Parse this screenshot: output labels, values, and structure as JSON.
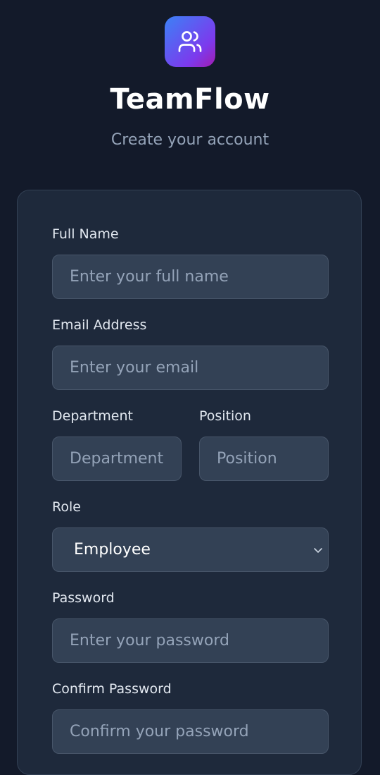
{
  "header": {
    "app_name": "TeamFlow",
    "subtitle": "Create your account",
    "logo_icon": "users-icon"
  },
  "form": {
    "full_name": {
      "label": "Full Name",
      "placeholder": "Enter your full name",
      "value": ""
    },
    "email": {
      "label": "Email Address",
      "placeholder": "Enter your email",
      "value": ""
    },
    "department": {
      "label": "Department",
      "placeholder": "Department",
      "value": ""
    },
    "position": {
      "label": "Position",
      "placeholder": "Position",
      "value": ""
    },
    "role": {
      "label": "Role",
      "selected": "Employee"
    },
    "password": {
      "label": "Password",
      "placeholder": "Enter your password",
      "value": ""
    },
    "confirm_password": {
      "label": "Confirm Password",
      "placeholder": "Confirm your password",
      "value": ""
    }
  },
  "colors": {
    "background": "#131a2a",
    "card": "#1e293b",
    "input": "#334155",
    "accent_gradient_start": "#3b82f6",
    "accent_gradient_end": "#a21caf"
  }
}
